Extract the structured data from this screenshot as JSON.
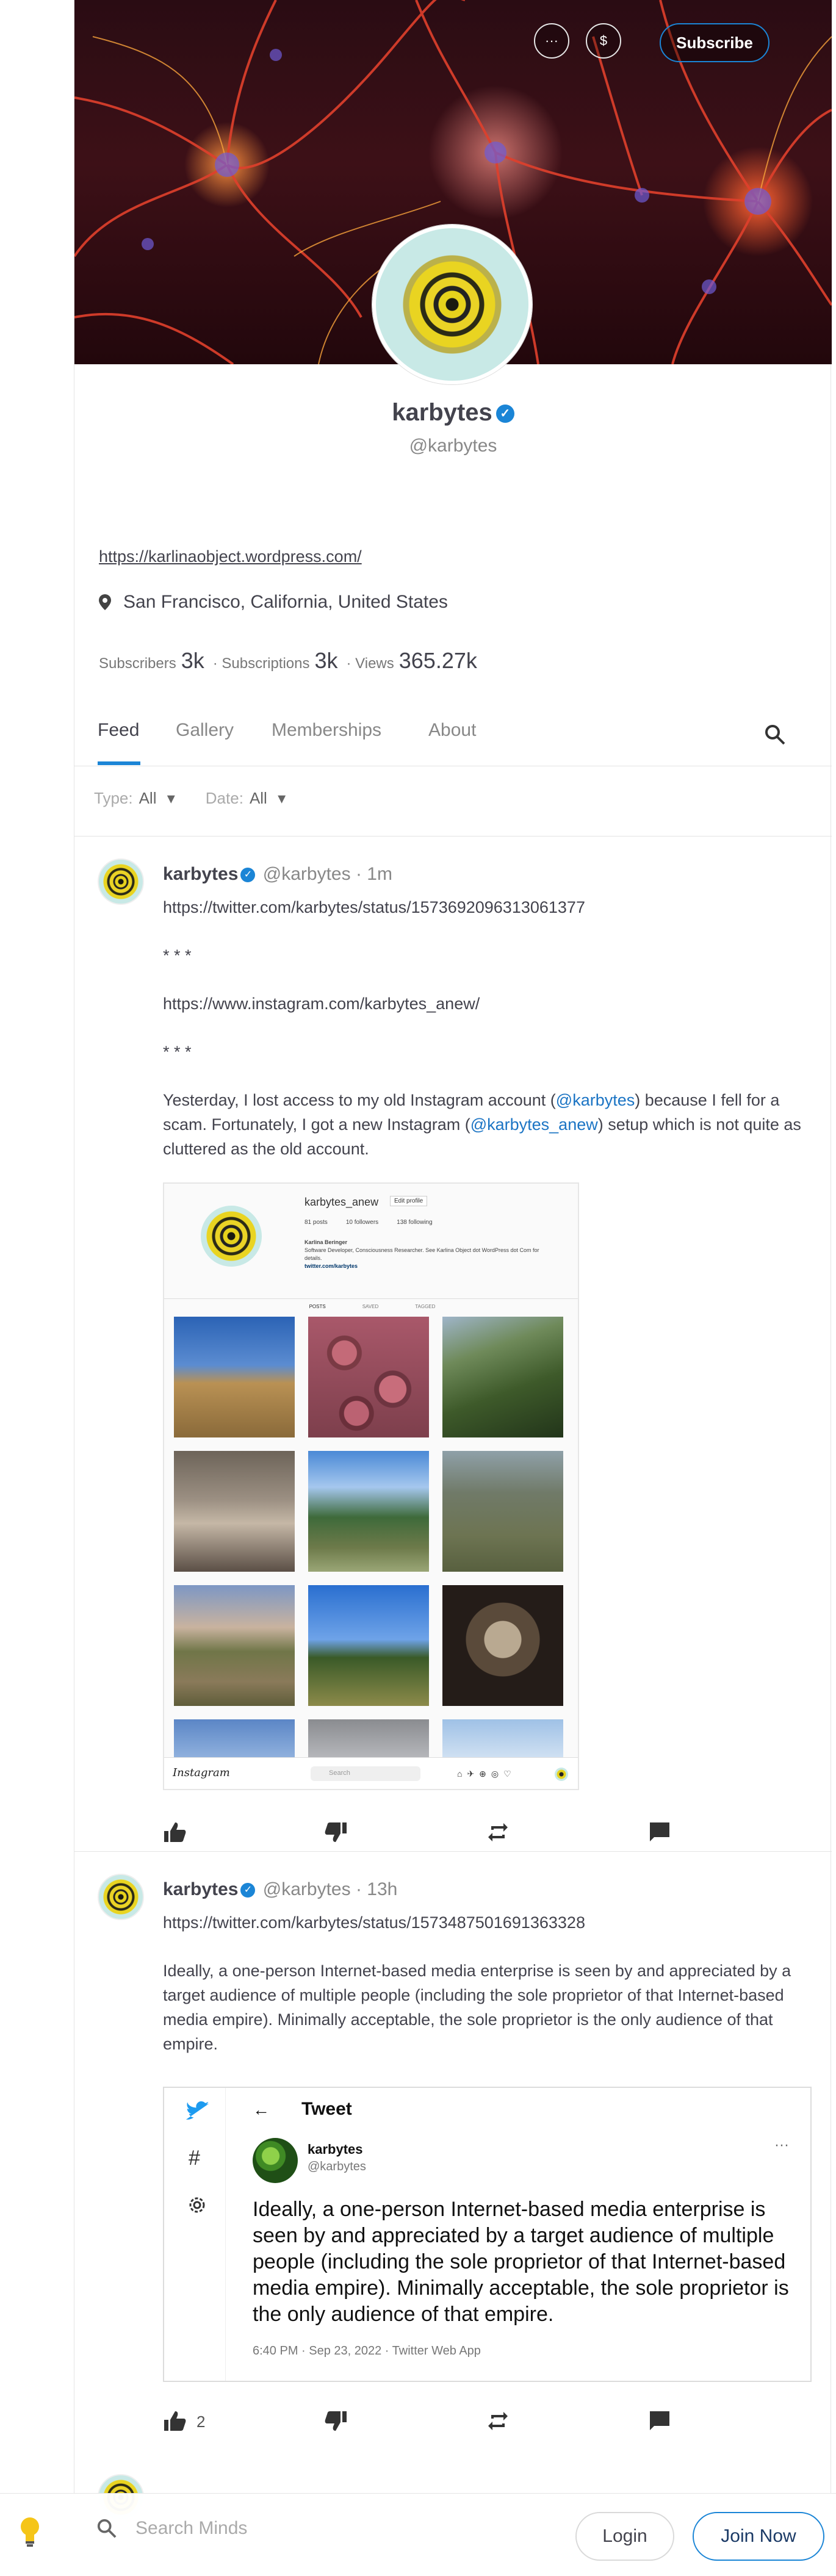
{
  "banner": {
    "more_icon_label": "···",
    "tip_icon_label": "$",
    "subscribe_label": "Subscribe"
  },
  "channel": {
    "name": "karbytes",
    "handle": "@karbytes",
    "website": "https://karlinaobject.wordpress.com/",
    "location": "San Francisco, California, United States",
    "stats": {
      "subscribers_label": "Subscribers",
      "subscribers": "3k",
      "subscriptions_label": "· Subscriptions",
      "subscriptions": "3k",
      "views_label": "· Views",
      "views": "365.27k"
    }
  },
  "tabs": [
    "Feed",
    "Gallery",
    "Memberships",
    "About"
  ],
  "filters": {
    "type_label": "Type:",
    "type_value": "All",
    "date_label": "Date:",
    "date_value": "All"
  },
  "posts": [
    {
      "author": "karbytes",
      "handle": "@karbytes",
      "time": "· 1m",
      "link": "https://twitter.com/karbytes/status/1573692096313061377",
      "stars1": "* * *",
      "link2": "https://www.instagram.com/karbytes_anew/",
      "stars2": "* * *",
      "text_a": "Yesterday, I lost access to my old Instagram account (",
      "mention1": "@karbytes",
      "text_b": ") because I fell for a scam. Fortunately, I got a new Instagram (",
      "mention2": "@karbytes_anew",
      "text_c": ") setup which is not quite as cluttered as the old account.",
      "embed": {
        "username": "karbytes_anew",
        "edit_profile": "Edit profile",
        "posts": "81 posts",
        "followers": "10 followers",
        "following": "138 following",
        "bio_name": "Karlina Beringer",
        "bio_text": "Software Developer, Consciousness Researcher. See Karlina Object dot WordPress dot Com for details.",
        "bio_link": "twitter.com/karbytes",
        "tab_posts": "POSTS",
        "tab_saved": "SAVED",
        "tab_tagged": "TAGGED",
        "brand": "Instagram",
        "search": "Search"
      },
      "likes": ""
    },
    {
      "author": "karbytes",
      "handle": "@karbytes",
      "time": "· 13h",
      "link": "https://twitter.com/karbytes/status/1573487501691363328",
      "text": "Ideally, a one-person Internet-based media enterprise is seen by and appreciated by a target audience of multiple people (including the sole proprietor of that Internet-based media empire). Minimally acceptable, the sole proprietor is the only audience of that empire.",
      "tweet": {
        "header": "Tweet",
        "name": "karbytes",
        "handle": "@karbytes",
        "body": "Ideally, a one-person Internet-based media enterprise is seen by and appreciated by a target audience of multiple people (including the sole proprietor of that Internet-based media empire). Minimally acceptable, the sole proprietor is the only audience of that empire.",
        "meta": "6:40 PM · Sep 23, 2022 · Twitter Web App"
      },
      "likes": "2"
    }
  ],
  "bottom": {
    "search_placeholder": "Search Minds",
    "login": "Login",
    "join": "Join Now"
  },
  "colors": {
    "accent": "#1b85d6",
    "link": "#1b74c4",
    "text": "#43434d"
  }
}
